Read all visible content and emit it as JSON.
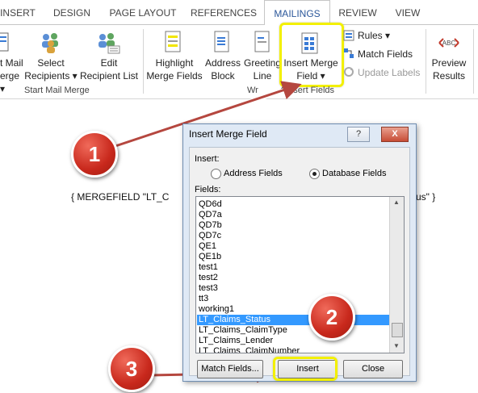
{
  "tabs": [
    "INSERT",
    "DESIGN",
    "PAGE LAYOUT",
    "REFERENCES",
    "MAILINGS",
    "REVIEW",
    "VIEW"
  ],
  "ribbon": {
    "start_mail_merge_partial": [
      "t Mail",
      "erge"
    ],
    "select_recipients": [
      "Select",
      "Recipients"
    ],
    "edit_recipient_list": [
      "Edit",
      "Recipient List"
    ],
    "highlight_merge_fields": [
      "Highlight",
      "Merge Fields"
    ],
    "address_block": [
      "Address",
      "Block"
    ],
    "greeting_line": [
      "Greeting",
      "Line"
    ],
    "insert_merge_field": [
      "Insert Merge",
      "Field"
    ],
    "rules": "Rules",
    "match_fields": "Match Fields",
    "update_labels": "Update Labels",
    "preview_results": [
      "Preview",
      "Results"
    ],
    "group_start_mail_merge": "Start Mail Merge",
    "group_write_insert_partial_a": "Wr",
    "group_write_insert_partial_b": "t Insert Fields"
  },
  "document": {
    "field_code_left": "{ MERGEFIELD \"LT_C",
    "field_code_right": "us\" }"
  },
  "dialog": {
    "title": "Insert Merge Field",
    "help_button": "?",
    "close_button": "X",
    "insert_label": "Insert:",
    "address_fields": "Address Fields",
    "database_fields": "Database Fields",
    "fields_label": "Fields:",
    "fields": [
      "QD6d",
      "QD7a",
      "QD7b",
      "QD7c",
      "QE1",
      "QE1b",
      "test1",
      "test2",
      "test3",
      "tt3",
      "working1",
      "LT_Claims_Status",
      "LT_Claims_ClaimType",
      "LT_Claims_Lender",
      "LT_Claims_ClaimNumber"
    ],
    "selected_field": "LT_Claims_Status",
    "match_fields_button": "Match Fields...",
    "insert_button": "Insert",
    "close_btn": "Close"
  },
  "annotations": {
    "step1": "1",
    "step2": "2",
    "step3": "3",
    "highlight_color": "#f3f000",
    "badge_color": "#c8281c",
    "arrow_color": "#b5473f"
  }
}
